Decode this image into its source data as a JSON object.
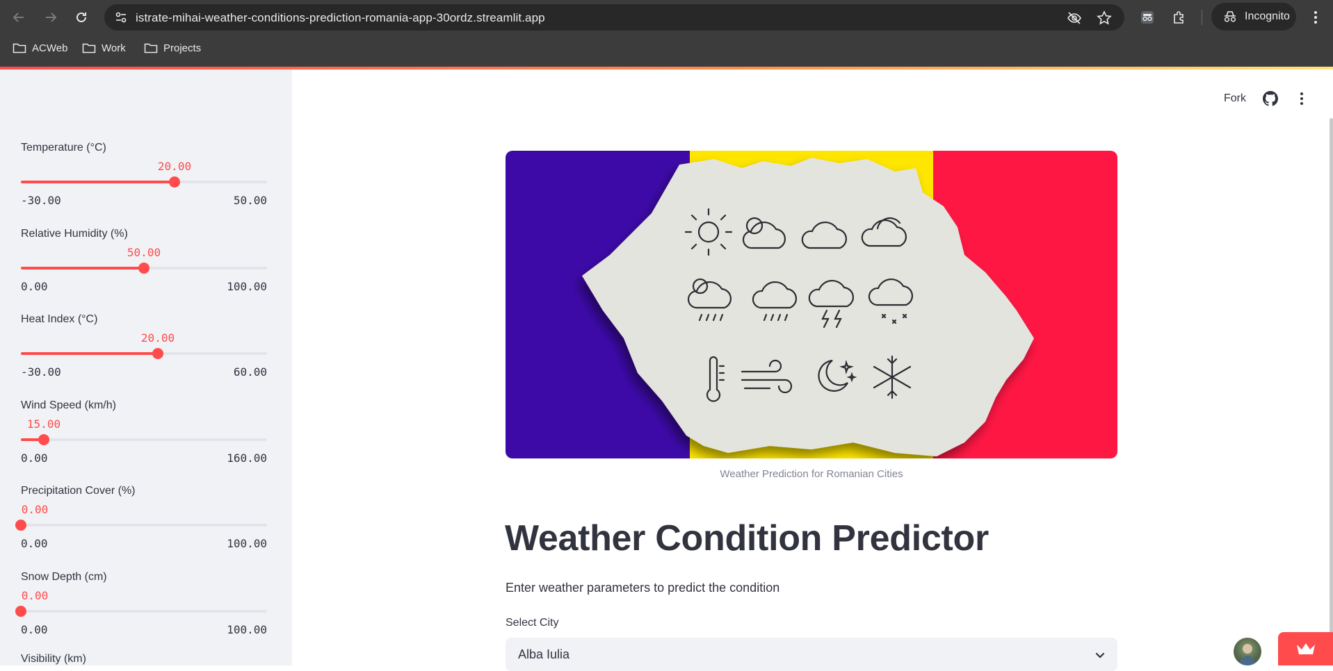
{
  "browser": {
    "url": "istrate-mihai-weather-conditions-prediction-romania-app-30ordz.streamlit.app",
    "profile_label": "Incognito",
    "bookmarks": [
      {
        "label": "ACWeb",
        "icon": "folder-icon"
      },
      {
        "label": "Work",
        "icon": "folder-icon"
      },
      {
        "label": "Projects",
        "icon": "folder-icon"
      }
    ]
  },
  "sidebar": {
    "sliders": [
      {
        "label": "Temperature (°C)",
        "value": "20.00",
        "min": "-30.00",
        "max": "50.00",
        "fraction": 0.625
      },
      {
        "label": "Relative Humidity (%)",
        "value": "50.00",
        "min": "0.00",
        "max": "100.00",
        "fraction": 0.5
      },
      {
        "label": "Heat Index (°C)",
        "value": "20.00",
        "min": "-30.00",
        "max": "60.00",
        "fraction": 0.5556
      },
      {
        "label": "Wind Speed (km/h)",
        "value": "15.00",
        "min": "0.00",
        "max": "160.00",
        "fraction": 0.0938
      },
      {
        "label": "Precipitation Cover (%)",
        "value": "0.00",
        "min": "0.00",
        "max": "100.00",
        "fraction": 0.0
      },
      {
        "label": "Snow Depth (cm)",
        "value": "0.00",
        "min": "0.00",
        "max": "100.00",
        "fraction": 0.0
      }
    ],
    "partial_label": "Visibility (km)"
  },
  "header": {
    "fork_label": "Fork"
  },
  "main": {
    "image_caption": "Weather Prediction for Romanian Cities",
    "title": "Weather Condition Predictor",
    "subtitle": "Enter weather parameters to predict the condition",
    "select_label": "Select City",
    "select_value": "Alba Iulia"
  },
  "colors": {
    "accent": "#ff4b4b",
    "flag_blue": "#3d0aa8",
    "flag_yellow": "#ffe600",
    "flag_red": "#ff1744"
  }
}
